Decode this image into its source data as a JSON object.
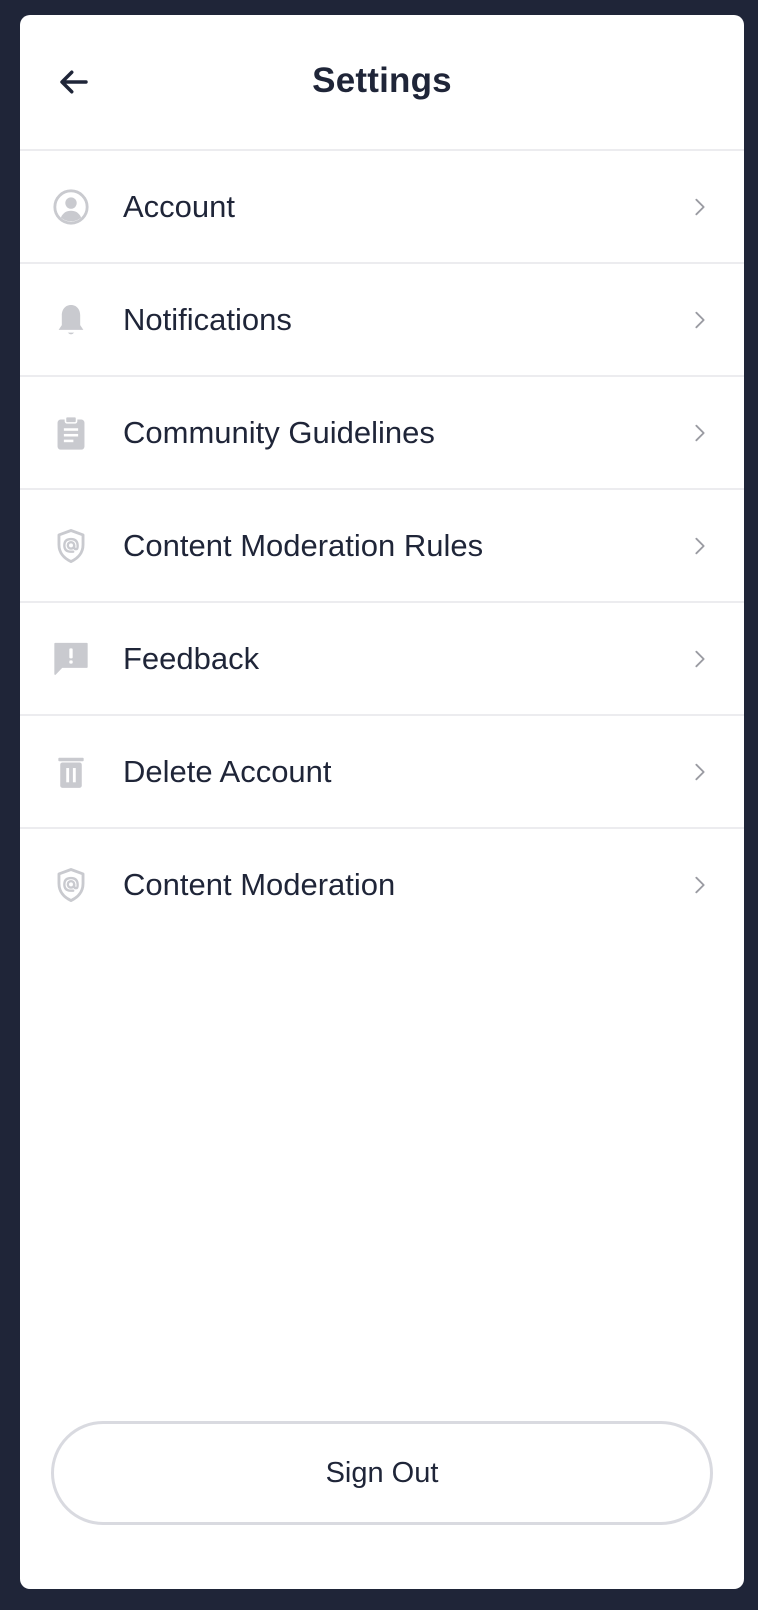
{
  "header": {
    "title": "Settings",
    "back_icon": "arrow-left-icon"
  },
  "menu": {
    "items": [
      {
        "label": "Account",
        "icon": "user-circle-icon"
      },
      {
        "label": "Notifications",
        "icon": "bell-icon"
      },
      {
        "label": "Community Guidelines",
        "icon": "clipboard-icon"
      },
      {
        "label": "Content Moderation Rules",
        "icon": "shield-at-icon"
      },
      {
        "label": "Feedback",
        "icon": "feedback-alert-icon"
      },
      {
        "label": "Delete Account",
        "icon": "trash-icon"
      },
      {
        "label": "Content Moderation",
        "icon": "shield-at-icon"
      }
    ],
    "chevron_icon": "chevron-right-icon"
  },
  "footer": {
    "sign_out_label": "Sign Out"
  },
  "colors": {
    "background": "#1f2538",
    "card": "#ffffff",
    "text": "#1f2538",
    "icon": "#c9cacf",
    "chevron": "#9a9ba2",
    "divider": "#ececef",
    "button_border": "#d9dae0"
  }
}
